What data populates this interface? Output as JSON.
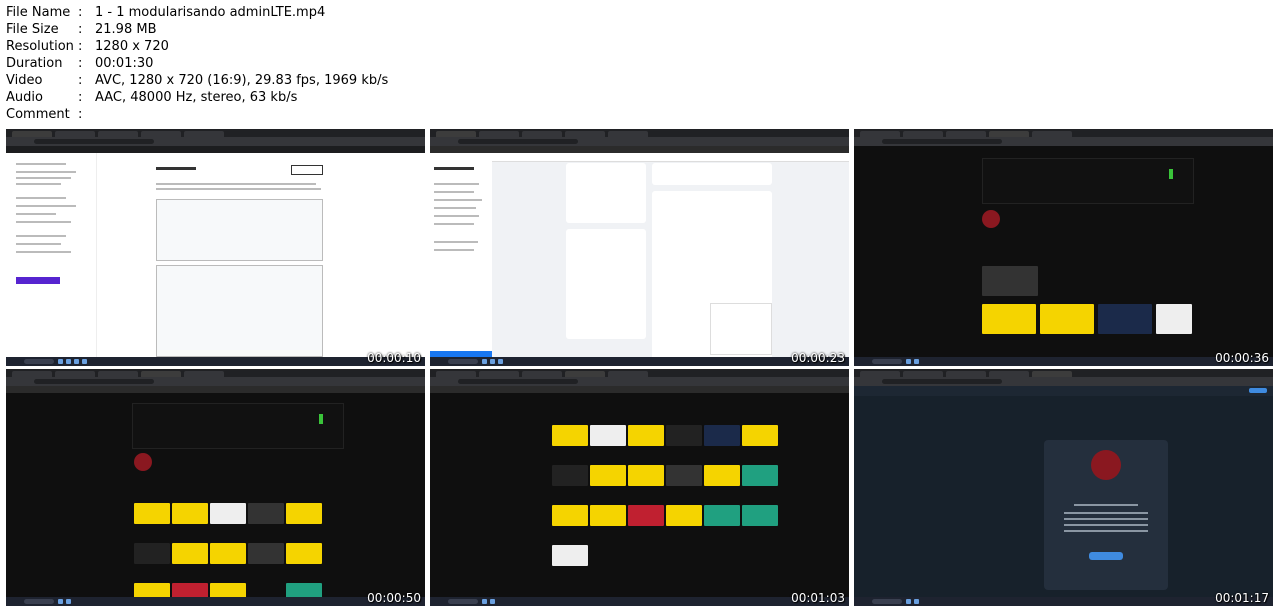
{
  "info": [
    {
      "key": "File Name",
      "value": "1 - 1 modularisando adminLTE.mp4"
    },
    {
      "key": "File Size",
      "value": "21.98 MB"
    },
    {
      "key": "Resolution",
      "value": "1280 x 720"
    },
    {
      "key": "Duration",
      "value": "00:01:30"
    },
    {
      "key": "Video",
      "value": "AVC, 1280 x 720 (16:9), 29.83 fps, 1969 kb/s"
    },
    {
      "key": "Audio",
      "value": "AAC, 48000 Hz, stereo, 63 kb/s"
    },
    {
      "key": "Comment",
      "value": ""
    }
  ],
  "separator": ":",
  "thumbnails": [
    {
      "timestamp": "00:00:10",
      "page": "course-editor"
    },
    {
      "timestamp": "00:00:23",
      "page": "facebook-admin"
    },
    {
      "timestamp": "00:00:36",
      "page": "youtube-channel"
    },
    {
      "timestamp": "00:00:50",
      "page": "youtube-channel"
    },
    {
      "timestamp": "00:01:03",
      "page": "youtube-videos"
    },
    {
      "timestamp": "00:01:17",
      "page": "telegram-channel"
    }
  ],
  "colors": {
    "browser_dark": "#202124",
    "youtube_bg": "#0f0f0f",
    "banner_accent": "#f2c200",
    "telegram_bg": "#17212b",
    "course_accent": "#5624d0"
  }
}
